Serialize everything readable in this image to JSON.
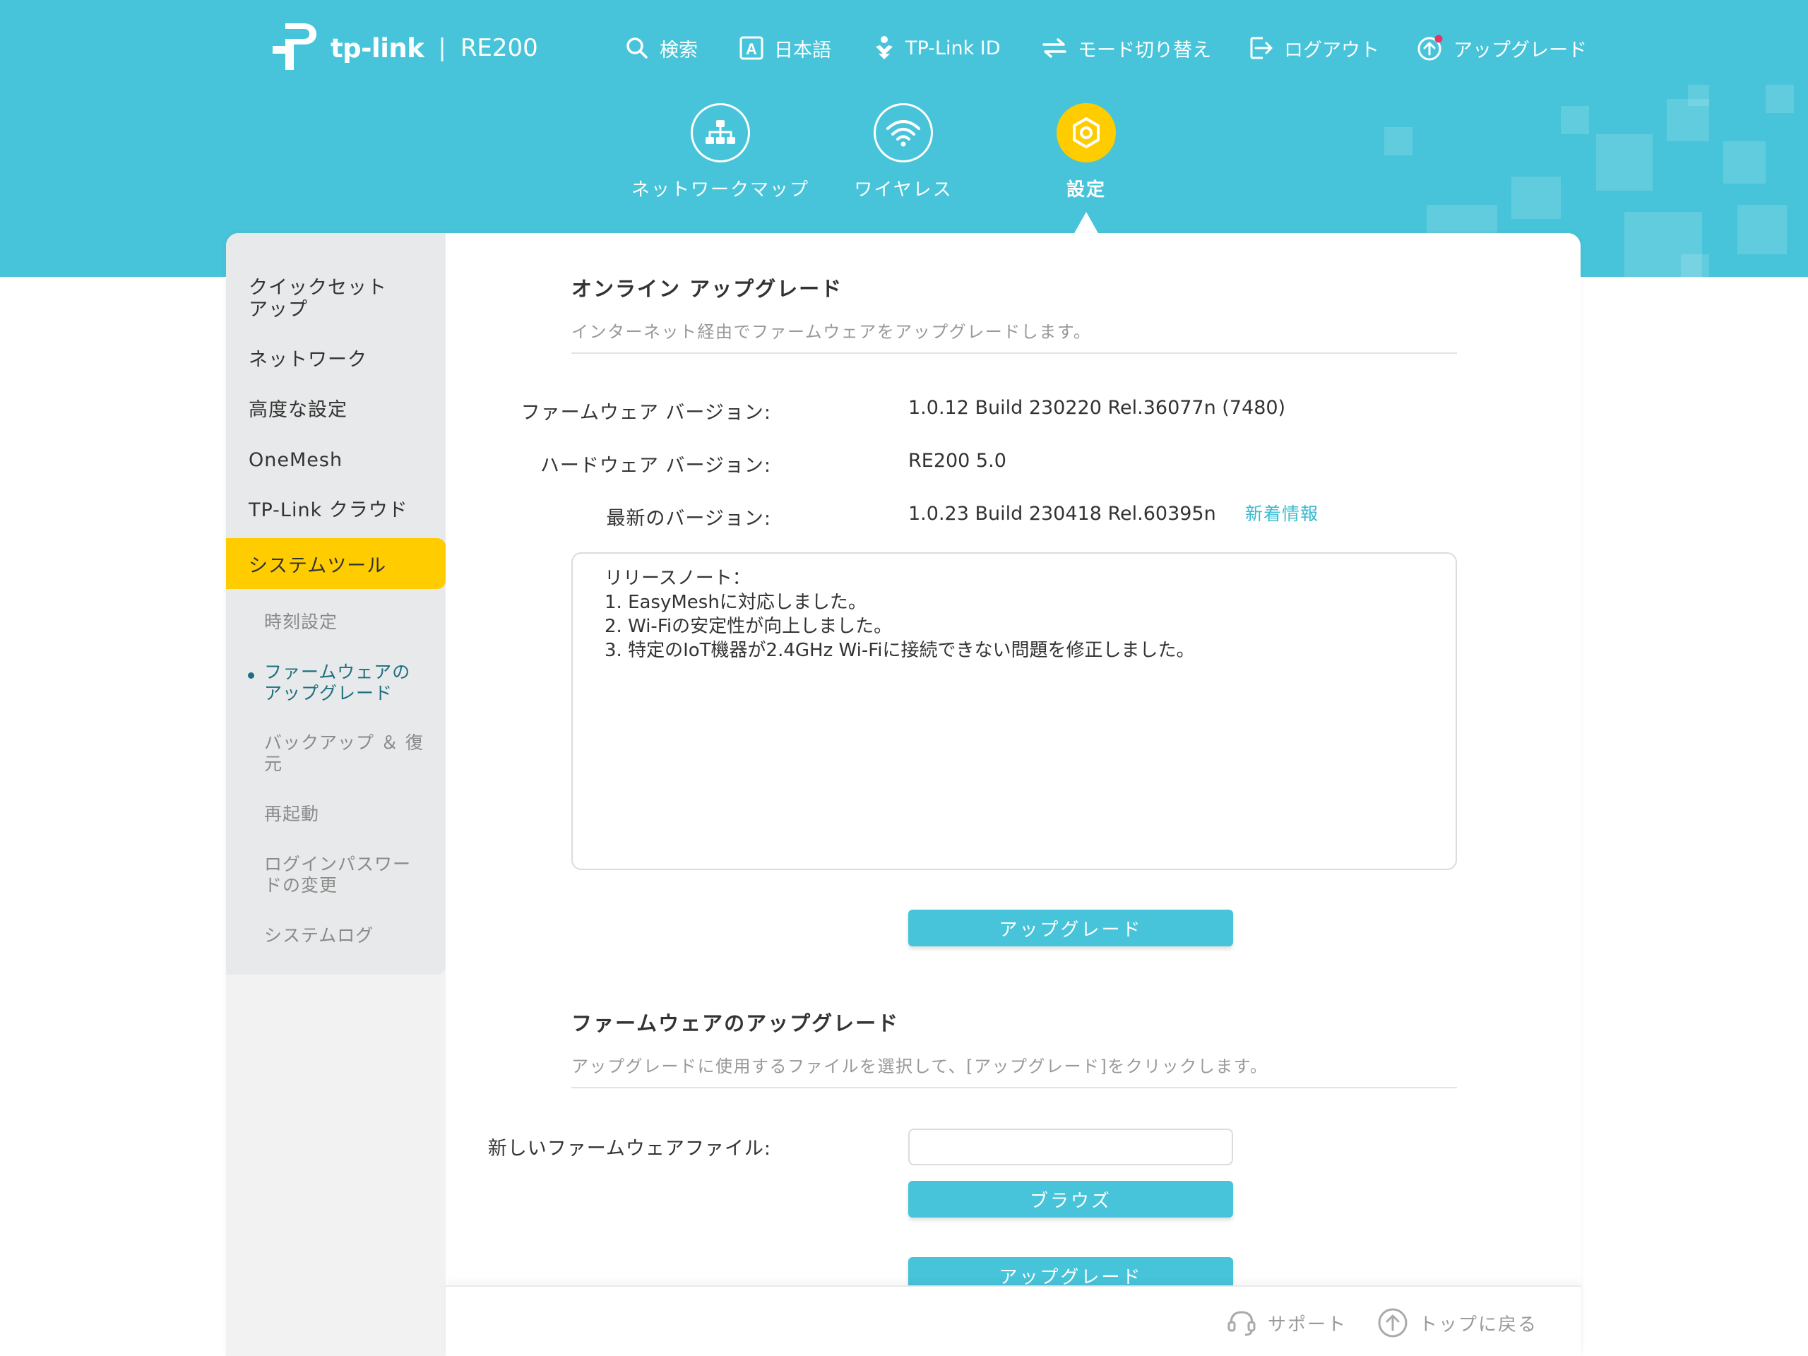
{
  "header": {
    "brand": "tp-link",
    "separator": "|",
    "model": "RE200",
    "top_nav": [
      {
        "label": "検索",
        "icon": "search-icon"
      },
      {
        "label": "日本語",
        "icon": "language-icon"
      },
      {
        "label": "TP-Link ID",
        "icon": "tplink-id-icon"
      },
      {
        "label": "モード切り替え",
        "icon": "mode-switch-icon"
      },
      {
        "label": "ログアウト",
        "icon": "logout-icon"
      },
      {
        "label": "アップグレード",
        "icon": "upgrade-icon"
      }
    ],
    "main_nav": [
      {
        "label": "ネットワークマップ",
        "icon": "network-map-icon"
      },
      {
        "label": "ワイヤレス",
        "icon": "wifi-icon"
      },
      {
        "label": "設定",
        "icon": "gear-icon",
        "active": true
      }
    ]
  },
  "sidebar": {
    "items": [
      "クイックセット\nアップ",
      "ネットワーク",
      "高度な設定",
      "OneMesh",
      "TP-Link クラウド"
    ],
    "active_item": "システムツール",
    "sub_items": [
      "時刻設定",
      "ファームウェアの\nアップグレード",
      "バックアップ ＆ 復\n元",
      "再起動",
      "ログインパスワー\nドの変更",
      "システムログ"
    ],
    "current_sub_item": "ファームウェアの\nアップグレード"
  },
  "online_upgrade": {
    "title": "オンライン アップグレード",
    "description": "インターネット経由でファームウェアをアップグレードします。",
    "firmware_version_label": "ファームウェア バージョン:",
    "firmware_version_value": "1.0.12 Build 230220 Rel.36077n (7480)",
    "hardware_version_label": "ハードウェア バージョン:",
    "hardware_version_value": "RE200 5.0",
    "latest_version_label": "最新のバージョン:",
    "latest_version_value": "1.0.23 Build 230418 Rel.60395n",
    "whats_new_link": "新着情報",
    "release_notes": [
      "リリースノート：",
      "1. EasyMeshに対応しました。",
      "2. Wi-Fiの安定性が向上しました。",
      "3. 特定のIoT機器が2.4GHz Wi-Fiに接続できない問題を修正しました。"
    ],
    "upgrade_button": "アップグレード"
  },
  "firmware_upgrade": {
    "title": "ファームウェアのアップグレード",
    "description": "アップグレードに使用するファイルを選択して、[アップグレード]をクリックします。",
    "file_label": "新しいファームウェアファイル:",
    "file_value": "",
    "browse_button": "ブラウズ",
    "upgrade_button": "アップグレード"
  },
  "footer": {
    "support": "サポート",
    "back_to_top": "トップに戻る"
  },
  "colors": {
    "header_bg": "#47c4d9",
    "accent_yellow": "#ffcc00",
    "button": "#47c4d9",
    "link": "#3bbad0"
  }
}
